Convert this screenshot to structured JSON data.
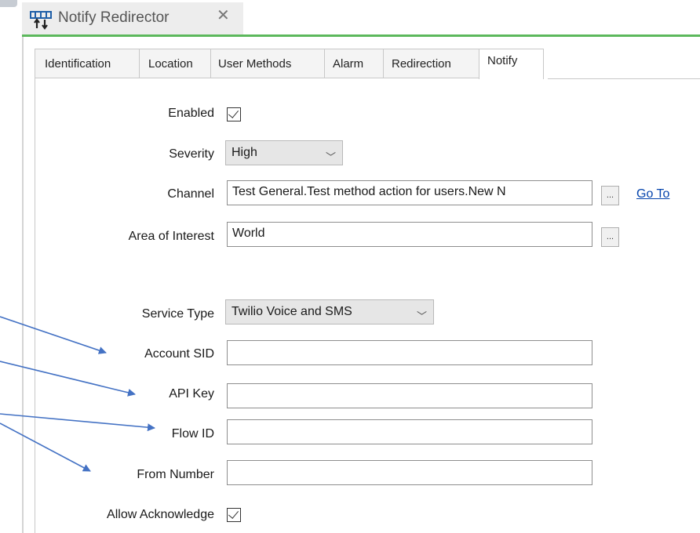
{
  "document_tab": {
    "title": "Notify Redirector",
    "close_glyph": "✕",
    "icon": "redirector-icon"
  },
  "tabs": [
    {
      "label": "Identification",
      "active": false
    },
    {
      "label": "Location",
      "active": false
    },
    {
      "label": "User Methods",
      "active": false
    },
    {
      "label": "Alarm",
      "active": false
    },
    {
      "label": "Redirection",
      "active": false
    },
    {
      "label": "Notify",
      "active": true
    }
  ],
  "form": {
    "enabled": {
      "label": "Enabled",
      "checked": true
    },
    "severity": {
      "label": "Severity",
      "value": "High"
    },
    "channel": {
      "label": "Channel",
      "value": "Test General.Test method action for users.New N",
      "browse": "...",
      "goto_label": "Go To"
    },
    "area_of_interest": {
      "label": "Area of Interest",
      "value": "World",
      "browse": "..."
    },
    "service_type": {
      "label": "Service Type",
      "value": "Twilio Voice and SMS"
    },
    "account_sid": {
      "label": "Account SID",
      "value": ""
    },
    "api_key": {
      "label": "API Key",
      "value": ""
    },
    "flow_id": {
      "label": "Flow ID",
      "value": ""
    },
    "from_number": {
      "label": "From Number",
      "value": ""
    },
    "allow_acknowledge": {
      "label": "Allow Acknowledge",
      "checked": true
    }
  },
  "colors": {
    "accent_line": "#5cb85c",
    "link": "#0645ad",
    "annotation_arrow": "#4472c4"
  }
}
